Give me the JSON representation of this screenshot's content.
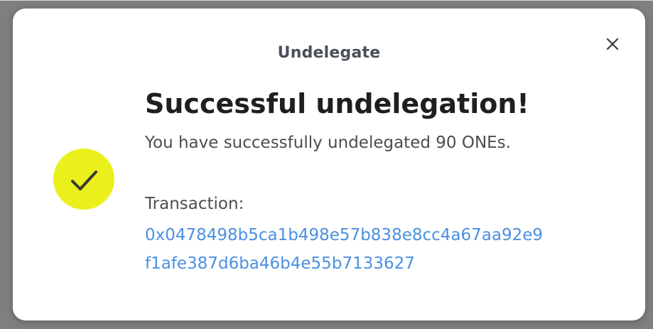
{
  "modal": {
    "title": "Undelegate",
    "close_icon": "close-icon",
    "status_icon": "checkmark-icon",
    "headline": "Successful undelegation!",
    "message": "You have successfully undelegated 90 ONEs.",
    "transaction_label": "Transaction:",
    "transaction_hash_line1": "0x0478498b5ca1b498e57b838e8cc4a67aa92e9",
    "transaction_hash_line2": "f1afe387d6ba46b4e55b7133627"
  },
  "colors": {
    "accent_yellow": "#ebf01d",
    "link_blue": "#4a90e2",
    "title_gray": "#4a4f5a",
    "backdrop": "#7f7f7f"
  }
}
